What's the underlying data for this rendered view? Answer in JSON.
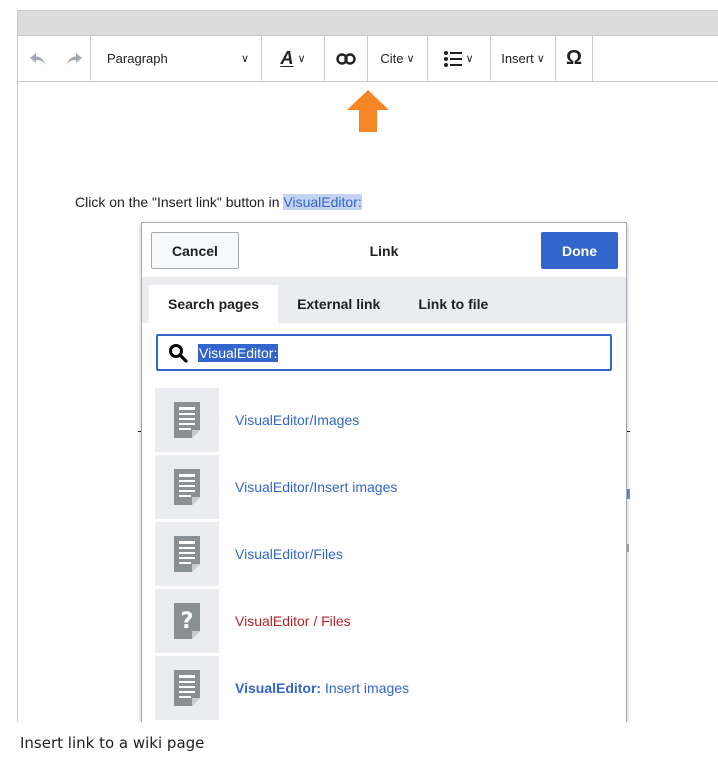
{
  "toolbar": {
    "paragraph_label": "Paragraph",
    "style_label": "A",
    "cite_label": "Cite",
    "insert_label": "Insert",
    "special_char_label": "Ω"
  },
  "content": {
    "sentence_text": "Click on the \"Insert link\" button in ",
    "selected_text": "VisualEditor:"
  },
  "dialog": {
    "title": "Link",
    "cancel_label": "Cancel",
    "done_label": "Done",
    "tabs": [
      {
        "label": "Search pages",
        "active": true
      },
      {
        "label": "External link",
        "active": false
      },
      {
        "label": "Link to file",
        "active": false
      }
    ],
    "search_value": "VisualEditor:",
    "results": [
      {
        "prefix": "",
        "title": "VisualEditor/Images",
        "type": "page"
      },
      {
        "prefix": "",
        "title": "VisualEditor/Insert images",
        "type": "page"
      },
      {
        "prefix": "",
        "title": "VisualEditor/Files",
        "type": "page"
      },
      {
        "prefix": "",
        "title": "VisualEditor / Files",
        "type": "missing"
      },
      {
        "prefix": "VisualEditor:",
        "title": " Insert images",
        "type": "page"
      }
    ]
  },
  "caption": "Insert link to a wiki page",
  "colors": {
    "accent": "#3366cc",
    "missing_link": "#b32424",
    "arrow": "#f68525"
  }
}
